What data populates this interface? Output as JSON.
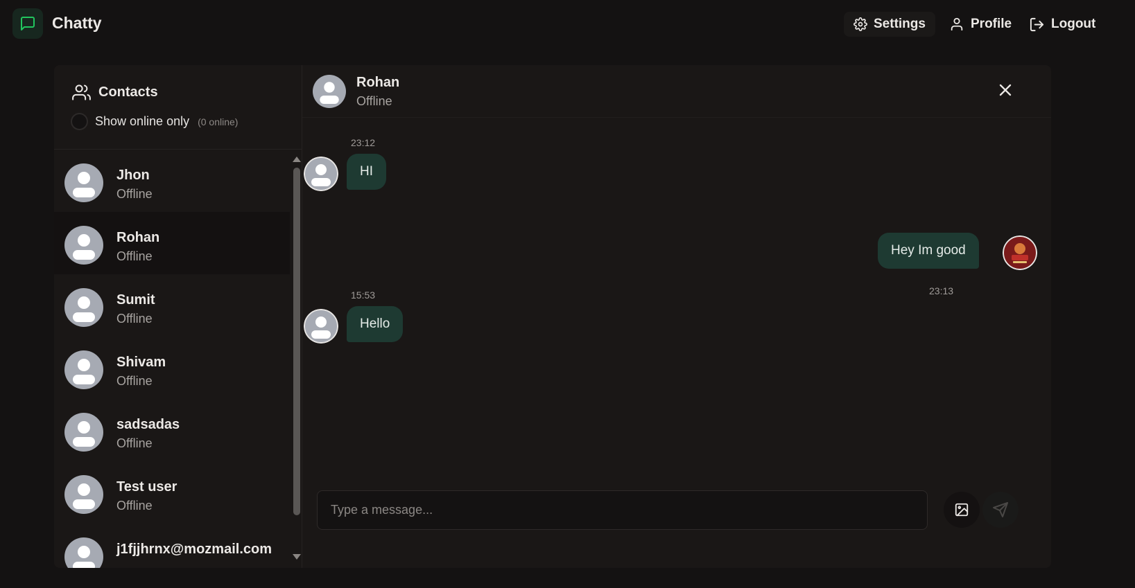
{
  "app": {
    "title": "Chatty",
    "brand_color": "#22c55e",
    "icon": "message-square-icon"
  },
  "nav": {
    "settings_label": "Settings",
    "profile_label": "Profile",
    "logout_label": "Logout"
  },
  "sidebar": {
    "title": "Contacts",
    "online_filter_label": "Show online only",
    "online_count": "(0 online)",
    "online_filter_checked": false,
    "contacts": [
      {
        "name": "Jhon",
        "status": "Offline",
        "selected": false
      },
      {
        "name": "Rohan",
        "status": "Offline",
        "selected": true
      },
      {
        "name": "Sumit",
        "status": "Offline",
        "selected": false
      },
      {
        "name": "Shivam",
        "status": "Offline",
        "selected": false
      },
      {
        "name": "sadsadas",
        "status": "Offline",
        "selected": false
      },
      {
        "name": "Test user",
        "status": "Offline",
        "selected": false
      },
      {
        "name": "j1fjjhrnx@mozmail.com",
        "status": "",
        "selected": false
      }
    ]
  },
  "chat": {
    "contact_name": "Rohan",
    "contact_status": "Offline",
    "messages": [
      {
        "time": "23:12",
        "text": "HI",
        "direction": "incoming"
      },
      {
        "time": "23:13",
        "text": "Hey Im good",
        "direction": "outgoing"
      },
      {
        "time": "15:53",
        "text": "Hello",
        "direction": "incoming"
      }
    ],
    "input_placeholder": "Type a message...",
    "input_value": ""
  },
  "colors": {
    "background": "#141212",
    "panel": "#1a1716",
    "bubble": "#1e3a32",
    "avatar_placeholder": "#a6aab3"
  }
}
